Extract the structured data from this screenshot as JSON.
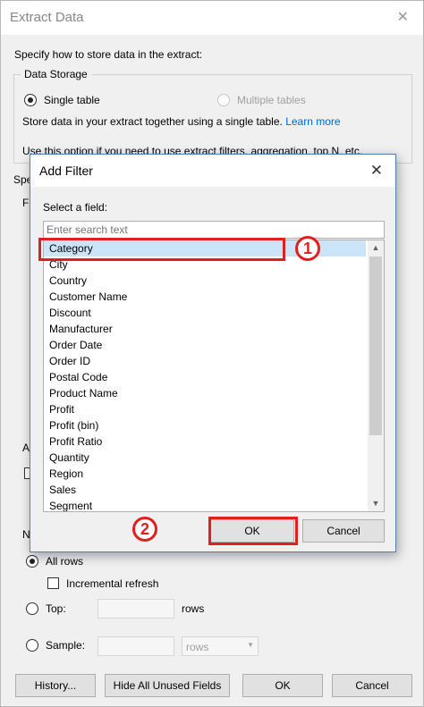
{
  "window": {
    "title": "Extract Data",
    "intro": "Specify how to store data in the extract:",
    "data_storage_label": "Data Storage",
    "single_table_label": "Single table",
    "multiple_tables_label": "Multiple tables",
    "single_table_desc": "Store data in your extract together using a single table.",
    "learn_more": "Learn more",
    "use_option_text": "Use this option if you need to use extract filters, aggregation, top N, etc.",
    "spe_partial": "Spe",
    "f_partial": "F",
    "a_partial": "A",
    "n_partial": "N",
    "all_rows_label": "All rows",
    "incremental_refresh_label": "Incremental refresh",
    "top_label": "Top:",
    "top_unit": "rows",
    "sample_label": "Sample:",
    "sample_unit": "rows",
    "buttons": {
      "history": "History...",
      "hide_unused": "Hide All Unused Fields",
      "ok": "OK",
      "cancel": "Cancel"
    }
  },
  "dialog": {
    "title": "Add Filter",
    "close_glyph": "✕",
    "select_field_label": "Select a field:",
    "search_placeholder": "Enter search text",
    "fields": [
      "Category",
      "City",
      "Country",
      "Customer Name",
      "Discount",
      "Manufacturer",
      "Order Date",
      "Order ID",
      "Postal Code",
      "Product Name",
      "Profit",
      "Profit (bin)",
      "Profit Ratio",
      "Quantity",
      "Region",
      "Sales",
      "Segment"
    ],
    "selected_field": "Category",
    "ok_label": "OK",
    "cancel_label": "Cancel"
  },
  "annotations": {
    "badge1": "1",
    "badge2": "2",
    "color": "#e02020"
  }
}
